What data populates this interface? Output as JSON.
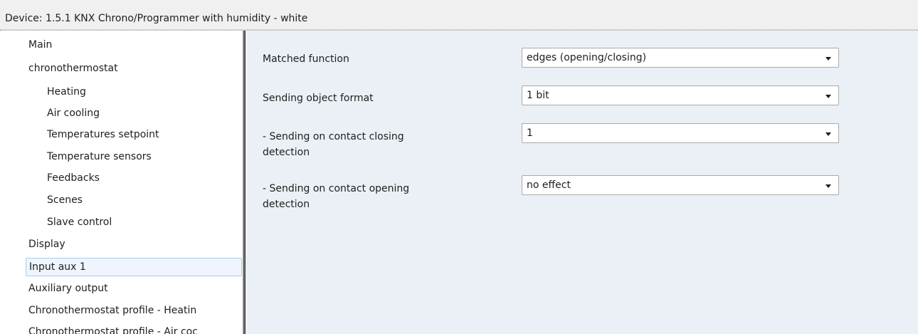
{
  "window": {
    "title": "Device: 1.5.1  KNX Chrono/Programmer with humidity - white"
  },
  "tree": {
    "items": [
      {
        "label": "Main",
        "level": 0
      },
      {
        "label": "chronothermostat",
        "level": 0
      },
      {
        "label": "Heating",
        "level": 1
      },
      {
        "label": "Air cooling",
        "level": 1
      },
      {
        "label": "Temperatures setpoint",
        "level": 1
      },
      {
        "label": "Temperature sensors",
        "level": 1
      },
      {
        "label": "Feedbacks",
        "level": 1
      },
      {
        "label": "Scenes",
        "level": 1
      },
      {
        "label": "Slave control",
        "level": 1
      },
      {
        "label": "Display",
        "level": 0
      },
      {
        "label": "Input aux 1",
        "level": 0,
        "selected": true
      },
      {
        "label": "Auxiliary output",
        "level": 0
      },
      {
        "label": "Chronothermostat profile - Heatin",
        "level": 0
      },
      {
        "label": "Chronothermostat profile - Air coc",
        "level": 0
      }
    ]
  },
  "parameters": [
    {
      "label": "Matched function",
      "value": "edges (opening/closing)"
    },
    {
      "label": "Sending object format",
      "value": "1 bit"
    },
    {
      "label": "- Sending on contact closing detection",
      "value": "1"
    },
    {
      "label": "- Sending on contact opening detection",
      "value": "no effect"
    }
  ],
  "colors": {
    "panel_background": "#eaf0f6",
    "selection_border": "#a7cdf0",
    "selection_fill": "#eef5fc",
    "splitter": "#6d6d6d"
  },
  "icons": {
    "dropdown": "chevron-down-icon"
  }
}
